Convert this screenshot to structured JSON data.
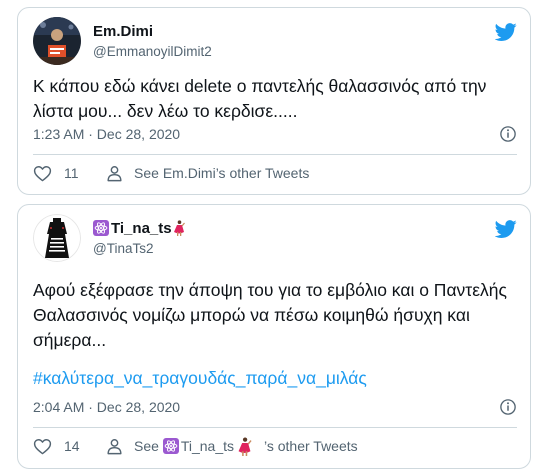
{
  "tweets": [
    {
      "display_name": "Em.Dimi",
      "handle": "@EmmanoyilDimit2",
      "text": "Κ κάπου εδώ κάνει delete ο παντελής θαλασσινός από την λίστα μου... δεν λέω το κερδισε.....",
      "hashtag": "",
      "timestamp": "1:23 AM · Dec 28, 2020",
      "like_count": "11",
      "see_other_prefix": "See ",
      "see_other_name": "Em.Dimi",
      "see_other_suffix": "’s other Tweets",
      "icons": [
        "avatar",
        "twitter-bird-icon",
        "info-icon",
        "heart-icon",
        "person-icon"
      ]
    },
    {
      "display_name": "Ti_na_ts",
      "handle": "@TinaTs2",
      "text": "Αφού εξέφρασε την άποψη του για το εμβόλιο και ο Παντελής Θαλασσινός νομίζω μπορώ να πέσω κοιμηθώ ήσυχη και σήμερα...",
      "hashtag": "#καλύτερα_να_τραγουδάς_παρά_να_μιλάς",
      "timestamp": "2:04 AM · Dec 28, 2020",
      "like_count": "14",
      "see_other_prefix": "See ",
      "see_other_name": "Ti_na_ts",
      "see_other_suffix": "’s other Tweets",
      "icons": [
        "atom-emoji-icon",
        "dancer-emoji-icon",
        "avatar",
        "twitter-bird-icon",
        "info-icon",
        "heart-icon",
        "person-icon"
      ]
    }
  ],
  "colors": {
    "text": "#0f1419",
    "secondary": "#536471",
    "link": "#1d9bf0",
    "border": "#cfd9de",
    "bird": "#1d9bf0"
  }
}
